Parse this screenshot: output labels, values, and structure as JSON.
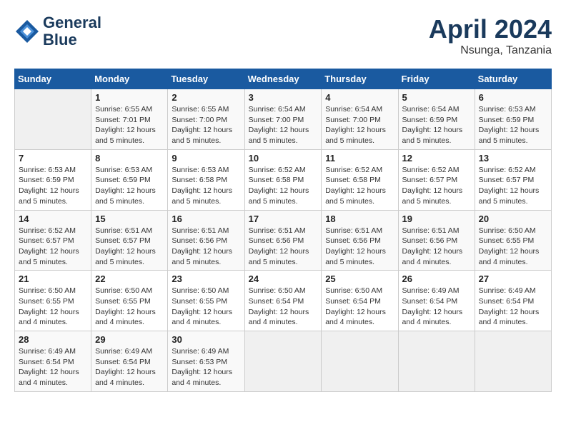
{
  "header": {
    "logo_line1": "General",
    "logo_line2": "Blue",
    "month_year": "April 2024",
    "location": "Nsunga, Tanzania"
  },
  "weekdays": [
    "Sunday",
    "Monday",
    "Tuesday",
    "Wednesday",
    "Thursday",
    "Friday",
    "Saturday"
  ],
  "weeks": [
    [
      {
        "day": "",
        "info": ""
      },
      {
        "day": "1",
        "info": "Sunrise: 6:55 AM\nSunset: 7:01 PM\nDaylight: 12 hours\nand 5 minutes."
      },
      {
        "day": "2",
        "info": "Sunrise: 6:55 AM\nSunset: 7:00 PM\nDaylight: 12 hours\nand 5 minutes."
      },
      {
        "day": "3",
        "info": "Sunrise: 6:54 AM\nSunset: 7:00 PM\nDaylight: 12 hours\nand 5 minutes."
      },
      {
        "day": "4",
        "info": "Sunrise: 6:54 AM\nSunset: 7:00 PM\nDaylight: 12 hours\nand 5 minutes."
      },
      {
        "day": "5",
        "info": "Sunrise: 6:54 AM\nSunset: 6:59 PM\nDaylight: 12 hours\nand 5 minutes."
      },
      {
        "day": "6",
        "info": "Sunrise: 6:53 AM\nSunset: 6:59 PM\nDaylight: 12 hours\nand 5 minutes."
      }
    ],
    [
      {
        "day": "7",
        "info": "Sunrise: 6:53 AM\nSunset: 6:59 PM\nDaylight: 12 hours\nand 5 minutes."
      },
      {
        "day": "8",
        "info": "Sunrise: 6:53 AM\nSunset: 6:59 PM\nDaylight: 12 hours\nand 5 minutes."
      },
      {
        "day": "9",
        "info": "Sunrise: 6:53 AM\nSunset: 6:58 PM\nDaylight: 12 hours\nand 5 minutes."
      },
      {
        "day": "10",
        "info": "Sunrise: 6:52 AM\nSunset: 6:58 PM\nDaylight: 12 hours\nand 5 minutes."
      },
      {
        "day": "11",
        "info": "Sunrise: 6:52 AM\nSunset: 6:58 PM\nDaylight: 12 hours\nand 5 minutes."
      },
      {
        "day": "12",
        "info": "Sunrise: 6:52 AM\nSunset: 6:57 PM\nDaylight: 12 hours\nand 5 minutes."
      },
      {
        "day": "13",
        "info": "Sunrise: 6:52 AM\nSunset: 6:57 PM\nDaylight: 12 hours\nand 5 minutes."
      }
    ],
    [
      {
        "day": "14",
        "info": "Sunrise: 6:52 AM\nSunset: 6:57 PM\nDaylight: 12 hours\nand 5 minutes."
      },
      {
        "day": "15",
        "info": "Sunrise: 6:51 AM\nSunset: 6:57 PM\nDaylight: 12 hours\nand 5 minutes."
      },
      {
        "day": "16",
        "info": "Sunrise: 6:51 AM\nSunset: 6:56 PM\nDaylight: 12 hours\nand 5 minutes."
      },
      {
        "day": "17",
        "info": "Sunrise: 6:51 AM\nSunset: 6:56 PM\nDaylight: 12 hours\nand 5 minutes."
      },
      {
        "day": "18",
        "info": "Sunrise: 6:51 AM\nSunset: 6:56 PM\nDaylight: 12 hours\nand 5 minutes."
      },
      {
        "day": "19",
        "info": "Sunrise: 6:51 AM\nSunset: 6:56 PM\nDaylight: 12 hours\nand 4 minutes."
      },
      {
        "day": "20",
        "info": "Sunrise: 6:50 AM\nSunset: 6:55 PM\nDaylight: 12 hours\nand 4 minutes."
      }
    ],
    [
      {
        "day": "21",
        "info": "Sunrise: 6:50 AM\nSunset: 6:55 PM\nDaylight: 12 hours\nand 4 minutes."
      },
      {
        "day": "22",
        "info": "Sunrise: 6:50 AM\nSunset: 6:55 PM\nDaylight: 12 hours\nand 4 minutes."
      },
      {
        "day": "23",
        "info": "Sunrise: 6:50 AM\nSunset: 6:55 PM\nDaylight: 12 hours\nand 4 minutes."
      },
      {
        "day": "24",
        "info": "Sunrise: 6:50 AM\nSunset: 6:54 PM\nDaylight: 12 hours\nand 4 minutes."
      },
      {
        "day": "25",
        "info": "Sunrise: 6:50 AM\nSunset: 6:54 PM\nDaylight: 12 hours\nand 4 minutes."
      },
      {
        "day": "26",
        "info": "Sunrise: 6:49 AM\nSunset: 6:54 PM\nDaylight: 12 hours\nand 4 minutes."
      },
      {
        "day": "27",
        "info": "Sunrise: 6:49 AM\nSunset: 6:54 PM\nDaylight: 12 hours\nand 4 minutes."
      }
    ],
    [
      {
        "day": "28",
        "info": "Sunrise: 6:49 AM\nSunset: 6:54 PM\nDaylight: 12 hours\nand 4 minutes."
      },
      {
        "day": "29",
        "info": "Sunrise: 6:49 AM\nSunset: 6:54 PM\nDaylight: 12 hours\nand 4 minutes."
      },
      {
        "day": "30",
        "info": "Sunrise: 6:49 AM\nSunset: 6:53 PM\nDaylight: 12 hours\nand 4 minutes."
      },
      {
        "day": "",
        "info": ""
      },
      {
        "day": "",
        "info": ""
      },
      {
        "day": "",
        "info": ""
      },
      {
        "day": "",
        "info": ""
      }
    ]
  ]
}
